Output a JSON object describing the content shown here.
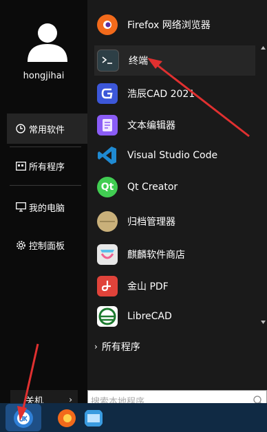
{
  "user": {
    "name": "hongjihai"
  },
  "nav": [
    {
      "label": "常用软件",
      "icon": "clock-icon"
    },
    {
      "label": "所有程序",
      "icon": "grid-icon"
    },
    {
      "label": "我的电脑",
      "icon": "monitor-icon"
    },
    {
      "label": "控制面板",
      "icon": "gear-icon"
    }
  ],
  "apps": [
    {
      "label": "Firefox 网络浏览器",
      "icon": "firefox-icon",
      "color": "#f26a1b"
    },
    {
      "label": "终端",
      "icon": "terminal-icon",
      "color": "#2d3f46"
    },
    {
      "label": "浩辰CAD 2021",
      "icon": "cad-icon",
      "color": "#3c57d9"
    },
    {
      "label": "文本编辑器",
      "icon": "text-editor-icon",
      "color": "#8a5cf6"
    },
    {
      "label": "Visual Studio Code",
      "icon": "vscode-icon",
      "color": "#1f8ad2"
    },
    {
      "label": "Qt Creator",
      "icon": "qt-icon",
      "color": "#41cd52"
    },
    {
      "label": "归档管理器",
      "icon": "archive-icon",
      "color": "#c9b07a"
    },
    {
      "label": "麒麟软件商店",
      "icon": "store-icon",
      "color": "#e8e8e8"
    },
    {
      "label": "金山 PDF",
      "icon": "pdf-icon",
      "color": "#e0433a"
    },
    {
      "label": "LibreCAD",
      "icon": "librecad-icon",
      "color": "#1d7a2f"
    }
  ],
  "all_programs": "所有程序",
  "power_label": "关机",
  "search": {
    "placeholder": "搜索本地程序"
  },
  "colors": {
    "accent_arrow": "#e03030",
    "taskbar": "#102a44"
  }
}
